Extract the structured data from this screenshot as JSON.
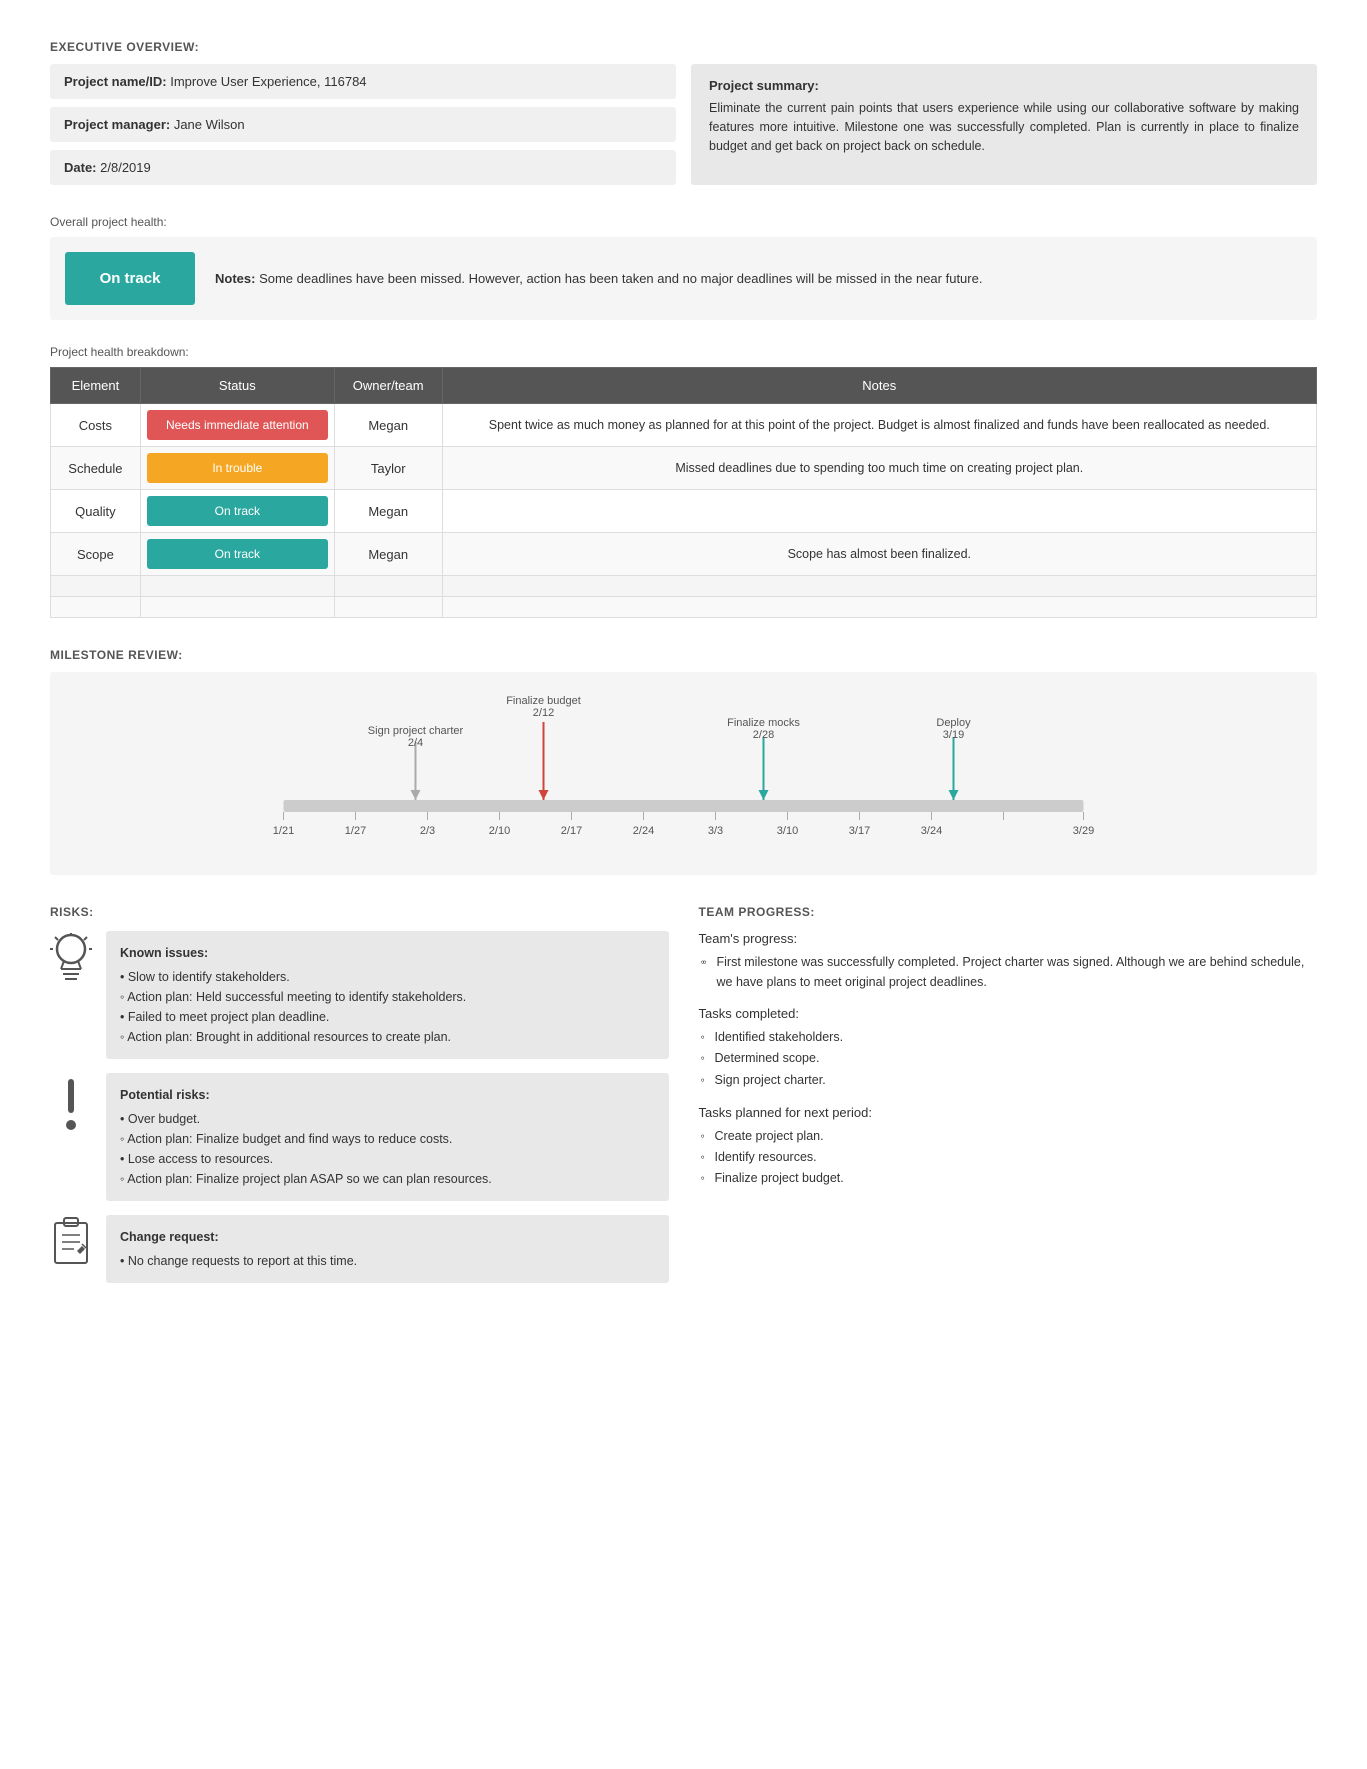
{
  "executive": {
    "title": "EXECUTIVE OVERVIEW:",
    "project_name_label": "Project name/ID:",
    "project_name_value": "Improve User Experience, 116784",
    "manager_label": "Project manager:",
    "manager_value": "Jane Wilson",
    "date_label": "Date:",
    "date_value": "2/8/2019",
    "summary_title": "Project summary:",
    "summary_text": "Eliminate the current pain points that users experience while using our collaborative software by making features more intuitive. Milestone one was successfully completed. Plan is currently in place to finalize budget and get back on project back on schedule."
  },
  "health": {
    "label": "Overall project health:",
    "status": "On track",
    "notes_label": "Notes:",
    "notes_text": "Some deadlines have been missed. However, action has been taken and no major deadlines will be missed in the near future."
  },
  "breakdown": {
    "label": "Project health breakdown:",
    "columns": [
      "Element",
      "Status",
      "Owner/team",
      "Notes"
    ],
    "rows": [
      {
        "element": "Costs",
        "status": "Needs immediate attention",
        "status_type": "red",
        "owner": "Megan",
        "notes": "Spent twice as much money as planned for at this point of the project. Budget is almost finalized and funds have been reallocated as needed."
      },
      {
        "element": "Schedule",
        "status": "In trouble",
        "status_type": "orange",
        "owner": "Taylor",
        "notes": "Missed deadlines due to spending too much time on creating project plan."
      },
      {
        "element": "Quality",
        "status": "On track",
        "status_type": "teal",
        "owner": "Megan",
        "notes": ""
      },
      {
        "element": "Scope",
        "status": "On track",
        "status_type": "teal",
        "owner": "Megan",
        "notes": "Scope has almost been finalized."
      },
      {
        "element": "",
        "status": "",
        "status_type": "empty",
        "owner": "",
        "notes": ""
      },
      {
        "element": "",
        "status": "",
        "status_type": "empty",
        "owner": "",
        "notes": ""
      }
    ]
  },
  "milestone": {
    "title": "MILESTONE REVIEW:",
    "milestones": [
      {
        "label": "Sign project charter",
        "date": "2/4",
        "position": 0.165,
        "color": "#aaa",
        "direction": "down"
      },
      {
        "label": "Finalize budget",
        "date": "2/12",
        "position": 0.33,
        "color": "#d0453a",
        "direction": "down"
      },
      {
        "label": "Finalize mocks",
        "date": "2/28",
        "position": 0.595,
        "color": "#2aa8a0",
        "direction": "down"
      },
      {
        "label": "Deploy",
        "date": "3/19",
        "position": 0.835,
        "color": "#2aa8a0",
        "direction": "down"
      }
    ],
    "axis_labels": [
      "1/21",
      "1/27",
      "2/3",
      "2/10",
      "2/17",
      "2/24",
      "3/3",
      "3/10",
      "3/17",
      "3/24",
      "3/29"
    ]
  },
  "risks": {
    "title": "RISKS:",
    "items": [
      {
        "icon_type": "bulb",
        "title": "Known issues:",
        "content": "• Slow to identify stakeholders.\n    ◦ Action plan: Held successful meeting to identify stakeholders.\n• Failed to meet project plan deadline.\n    ◦ Action plan: Brought in additional resources to create plan."
      },
      {
        "icon_type": "exclaim",
        "title": "Potential risks:",
        "content": "• Over budget.\n    ◦ Action plan: Finalize budget and find ways to reduce costs.\n• Lose access to resources.\n    ◦ Action plan: Finalize project plan ASAP so we can plan resources."
      },
      {
        "icon_type": "clipboard",
        "title": "Change request:",
        "content": "• No change requests to report at this time."
      }
    ]
  },
  "team": {
    "title": "TEAM PROGRESS:",
    "progress_label": "Team's progress:",
    "progress_text": "First milestone was successfully completed. Project charter was signed. Although we are behind schedule, we have plans to meet original project deadlines.",
    "completed_label": "Tasks completed:",
    "completed_items": [
      "Identified stakeholders.",
      "Determined scope.",
      "Sign project charter."
    ],
    "planned_label": "Tasks planned for next period:",
    "planned_items": [
      "Create project plan.",
      "Identify resources.",
      "Finalize project budget."
    ]
  }
}
